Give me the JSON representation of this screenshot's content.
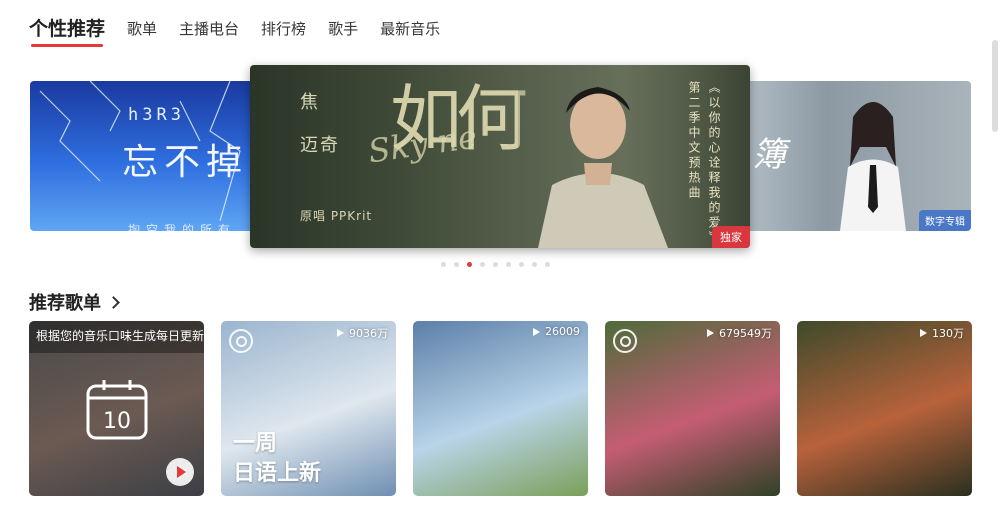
{
  "tabs": [
    "个性推荐",
    "歌单",
    "主播电台",
    "排行榜",
    "歌手",
    "最新音乐"
  ],
  "banners": {
    "left": {
      "artist": "h3R3",
      "title": "忘不掉",
      "subtitle": "掏空我的所有"
    },
    "center": {
      "artist_line1": "焦",
      "artist_line2": "迈奇",
      "song_title": "如何",
      "script_text": "Sky ne",
      "original_singer": "原唱 PPKrit",
      "vertical_left": "第二季中文预热曲",
      "vertical_right": "《以你的心诠释我的爱》",
      "badge": "独家"
    },
    "right": {
      "title": "簿",
      "badge": "数字专辑"
    }
  },
  "carousel": {
    "count": 9,
    "active_index": 2
  },
  "section": {
    "title": "推荐歌单"
  },
  "playlists": [
    {
      "type": "daily",
      "caption": "根据您的音乐口味生成每日更新",
      "day": "10",
      "colors": [
        "#4a4a4a",
        "#6b5a52",
        "#3c3f45"
      ]
    },
    {
      "plays": "9036万",
      "overlay": "一周\n日语上新",
      "has_logo": true,
      "colors": [
        "#9bb5cf",
        "#dfe7ee",
        "#6e8fb2"
      ]
    },
    {
      "plays": "26009",
      "has_logo": false,
      "colors": [
        "#5c7fa8",
        "#b9d4e9",
        "#7aa05a"
      ]
    },
    {
      "plays": "679549万",
      "has_logo": true,
      "colors": [
        "#4e6b3a",
        "#c55d74",
        "#2f4226"
      ]
    },
    {
      "plays": "130万",
      "has_logo": false,
      "colors": [
        "#3e4a2b",
        "#b8623b",
        "#2a3020"
      ]
    }
  ]
}
